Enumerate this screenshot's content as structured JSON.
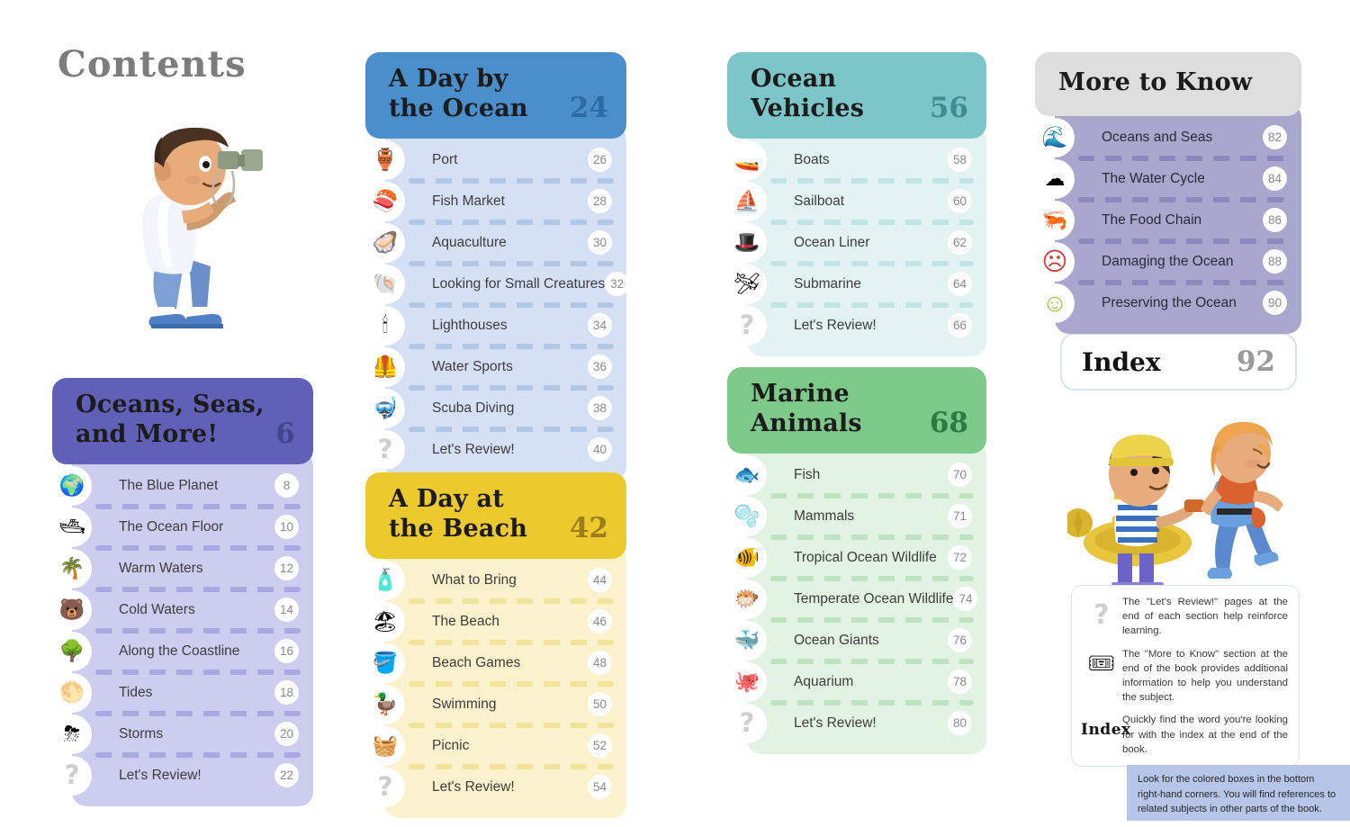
{
  "page_title": "Contents",
  "sections": [
    {
      "id": "oceans-seas-and-more",
      "theme": "t-purple",
      "title": "Oceans, Seas,\nand More!",
      "page": "6",
      "rows": [
        {
          "icon": "earth-globe-icon",
          "glyph": "🌍",
          "label": "The Blue Planet",
          "page": "8"
        },
        {
          "icon": "submarine-yellow-icon",
          "glyph": "🛥",
          "label": "The Ocean Floor",
          "page": "10"
        },
        {
          "icon": "palm-tree-icon",
          "glyph": "🌴",
          "label": "Warm Waters",
          "page": "12"
        },
        {
          "icon": "polar-bear-icon",
          "glyph": "🐻",
          "label": "Cold Waters",
          "page": "14"
        },
        {
          "icon": "tree-icon",
          "glyph": "🌳",
          "label": "Along the Coastline",
          "page": "16"
        },
        {
          "icon": "moon-icon",
          "glyph": "🌕",
          "label": "Tides",
          "page": "18"
        },
        {
          "icon": "storm-cloud-icon",
          "glyph": "⛈",
          "label": "Storms",
          "page": "20"
        },
        {
          "icon": "question-mark-icon",
          "glyph": "?",
          "label": "Let's Review!",
          "page": "22",
          "q": true
        }
      ]
    },
    {
      "id": "a-day-by-the-ocean",
      "theme": "t-blue",
      "title": "A Day by\nthe Ocean",
      "page": "24",
      "rows": [
        {
          "icon": "pot-icon",
          "glyph": "🏺",
          "label": "Port",
          "page": "26"
        },
        {
          "icon": "fish-fillet-icon",
          "glyph": "🍣",
          "label": "Fish Market",
          "page": "28"
        },
        {
          "icon": "oyster-icon",
          "glyph": "🦪",
          "label": "Aquaculture",
          "page": "30"
        },
        {
          "icon": "shell-icon",
          "glyph": "🐚",
          "label": "Looking for Small Creatures",
          "page": "32"
        },
        {
          "icon": "lighthouse-icon",
          "glyph": "🕯",
          "label": "Lighthouses",
          "page": "34"
        },
        {
          "icon": "life-vest-icon",
          "glyph": "🦺",
          "label": "Water Sports",
          "page": "36"
        },
        {
          "icon": "scuba-tank-icon",
          "glyph": "🤿",
          "label": "Scuba Diving",
          "page": "38"
        },
        {
          "icon": "question-mark-icon",
          "glyph": "?",
          "label": "Let's Review!",
          "page": "40",
          "q": true
        }
      ]
    },
    {
      "id": "a-day-at-the-beach",
      "theme": "t-yellow",
      "title": "A Day at\nthe Beach",
      "page": "42",
      "rows": [
        {
          "icon": "sunscreen-icon",
          "glyph": "🧴",
          "label": "What to Bring",
          "page": "44"
        },
        {
          "icon": "beach-umbrella-icon",
          "glyph": "🏖",
          "label": "The Beach",
          "page": "46"
        },
        {
          "icon": "bucket-icon",
          "glyph": "🪣",
          "label": "Beach Games",
          "page": "48"
        },
        {
          "icon": "rubber-duck-icon",
          "glyph": "🦆",
          "label": "Swimming",
          "page": "50"
        },
        {
          "icon": "picnic-basket-icon",
          "glyph": "🧺",
          "label": "Picnic",
          "page": "52"
        },
        {
          "icon": "question-mark-icon",
          "glyph": "?",
          "label": "Let's Review!",
          "page": "54",
          "q": true
        }
      ]
    },
    {
      "id": "ocean-vehicles",
      "theme": "t-teal",
      "title": "Ocean\nVehicles",
      "page": "56",
      "rows": [
        {
          "icon": "motorboat-icon",
          "glyph": "🚤",
          "label": "Boats",
          "page": "58"
        },
        {
          "icon": "sailboat-icon",
          "glyph": "⛵",
          "label": "Sailboat",
          "page": "60"
        },
        {
          "icon": "captain-hat-icon",
          "glyph": "🎩",
          "label": "Ocean Liner",
          "page": "62"
        },
        {
          "icon": "submarine-icon",
          "glyph": "🛩",
          "label": "Submarine",
          "page": "64"
        },
        {
          "icon": "question-mark-icon",
          "glyph": "?",
          "label": "Let's Review!",
          "page": "66",
          "q": true
        }
      ]
    },
    {
      "id": "marine-animals",
      "theme": "t-green",
      "title": "Marine\nAnimals",
      "page": "68",
      "rows": [
        {
          "icon": "tuna-fish-icon",
          "glyph": "🐟",
          "label": "Fish",
          "page": "70"
        },
        {
          "icon": "bubbles-icon",
          "glyph": "🫧",
          "label": "Mammals",
          "page": "71"
        },
        {
          "icon": "clownfish-icon",
          "glyph": "🐠",
          "label": "Tropical Ocean Wildlife",
          "page": "72"
        },
        {
          "icon": "anglerfish-icon",
          "glyph": "🐡",
          "label": "Temperate Ocean Wildlife",
          "page": "74"
        },
        {
          "icon": "whale-icon",
          "glyph": "🐳",
          "label": "Ocean Giants",
          "page": "76"
        },
        {
          "icon": "aquarium-tank-icon",
          "glyph": "🐙",
          "label": "Aquarium",
          "page": "78"
        },
        {
          "icon": "question-mark-icon",
          "glyph": "?",
          "label": "Let's Review!",
          "page": "80",
          "q": true
        }
      ]
    },
    {
      "id": "more-to-know",
      "theme": "t-gray",
      "title": "More to Know",
      "page": "",
      "rows": [
        {
          "icon": "globe-water-icon",
          "glyph": "🌊",
          "label": "Oceans and Seas",
          "page": "82"
        },
        {
          "icon": "cloud-icon",
          "glyph": "☁",
          "label": "The Water Cycle",
          "page": "84"
        },
        {
          "icon": "plankton-icon",
          "glyph": "🦐",
          "label": "The Food Chain",
          "page": "86"
        },
        {
          "icon": "sad-face-red-icon",
          "glyph": "☹",
          "label": "Damaging the Ocean",
          "page": "88"
        },
        {
          "icon": "happy-face-green-icon",
          "glyph": "☺",
          "label": "Preserving the Ocean",
          "page": "90"
        }
      ]
    }
  ],
  "index_card": {
    "label": "Index",
    "page": "92"
  },
  "legend": {
    "rows": [
      {
        "icon": "question-mark-icon",
        "glyph": "?",
        "text": "The \"Let's Review!\" pages at the end of each section help reinforce learning."
      },
      {
        "icon": "info-card-icon",
        "glyph": "🎟",
        "text": "The \"More to Know\" section at the end of the book provides additional information to help you understand the subject."
      },
      {
        "icon": "index-word-icon",
        "glyph": "Index",
        "text": "Quickly find the word you're looking for with the index at the end of the book."
      }
    ]
  },
  "footer_note": "Look for the colored boxes in the bottom right-hand corners. You will find references to related subjects in other parts of the book.",
  "colors": {
    "purple": "#6160b8",
    "blue": "#4a8ecb",
    "yellow": "#ecc92c",
    "teal": "#7cc6c9",
    "green": "#7dc98a",
    "gray": "#dededf",
    "purple_body": "#a9a7ce",
    "footer_note_bg": "#b6c6e8",
    "title_gray": "#7d7d7d"
  }
}
